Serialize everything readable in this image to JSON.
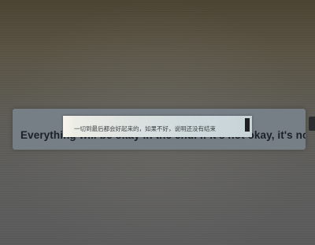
{
  "subtitles": {
    "english": "Everything will be okay in the end. If it's not okay, it's not the end",
    "chinese": "一切到最后都会好起来的，如果不好，说明还没有结束"
  },
  "colors": {
    "bar": "#767e86",
    "english_text": "#1c2126",
    "chinese_text": "#3c4144"
  }
}
